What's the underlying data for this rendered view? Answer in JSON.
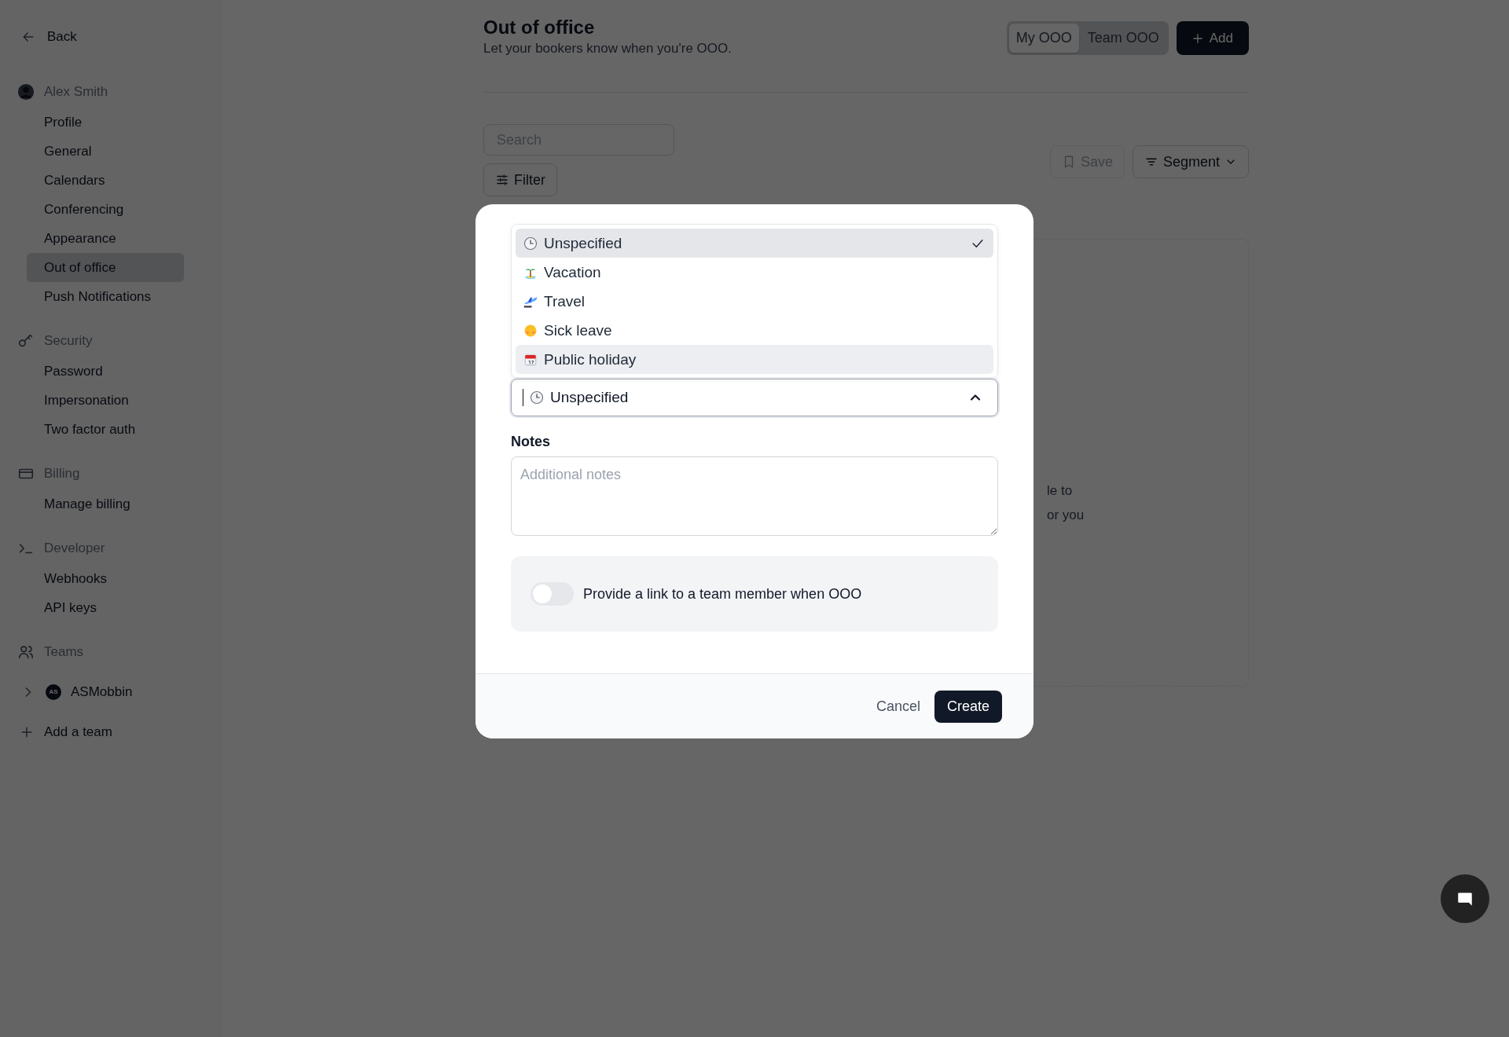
{
  "sidebar": {
    "back": "Back",
    "sections": [
      {
        "title": "Alex Smith",
        "items": [
          {
            "label": "Profile",
            "selected": false
          },
          {
            "label": "General",
            "selected": false
          },
          {
            "label": "Calendars",
            "selected": false
          },
          {
            "label": "Conferencing",
            "selected": false
          },
          {
            "label": "Appearance",
            "selected": false
          },
          {
            "label": "Out of office",
            "selected": true
          },
          {
            "label": "Push Notifications",
            "selected": false
          }
        ]
      },
      {
        "title": "Security",
        "items": [
          {
            "label": "Password",
            "selected": false
          },
          {
            "label": "Impersonation",
            "selected": false
          },
          {
            "label": "Two factor auth",
            "selected": false
          }
        ]
      },
      {
        "title": "Billing",
        "items": [
          {
            "label": "Manage billing",
            "selected": false
          }
        ]
      },
      {
        "title": "Developer",
        "items": [
          {
            "label": "Webhooks",
            "selected": false
          },
          {
            "label": "API keys",
            "selected": false
          }
        ]
      },
      {
        "title": "Teams"
      }
    ],
    "teams": [
      {
        "name": "ASMobbin",
        "initials": "AS",
        "expanded": false
      }
    ],
    "add_team": "Add a team"
  },
  "header": {
    "title": "Out of office",
    "subtitle": "Let your bookers know when you're OOO.",
    "toggle": [
      {
        "label": "My OOO",
        "selected": true
      },
      {
        "label": "Team OOO",
        "selected": false
      }
    ],
    "add_button": "Add"
  },
  "toolbar": {
    "search_placeholder": "Search",
    "filter": "Filter",
    "save": {
      "label": "Save",
      "disabled": true
    },
    "segment": "Segment"
  },
  "empty_state": {
    "lines": [
      "le to",
      "or you"
    ]
  },
  "modal": {
    "options": [
      {
        "label": "Unspecified",
        "selected": true,
        "highlighted": false
      },
      {
        "label": "Vacation",
        "selected": false,
        "highlighted": false
      },
      {
        "label": "Travel",
        "selected": false,
        "highlighted": false
      },
      {
        "label": "Sick leave",
        "selected": false,
        "highlighted": false
      },
      {
        "label": "Public holiday",
        "selected": false,
        "highlighted": true
      }
    ],
    "select": {
      "value": "Unspecified",
      "expanded": true
    },
    "notes_label": "Notes",
    "notes_placeholder": "Additional notes",
    "toggle": {
      "label": "Provide a link to a team member when OOO",
      "on": false
    },
    "cancel": "Cancel",
    "create": "Create"
  }
}
